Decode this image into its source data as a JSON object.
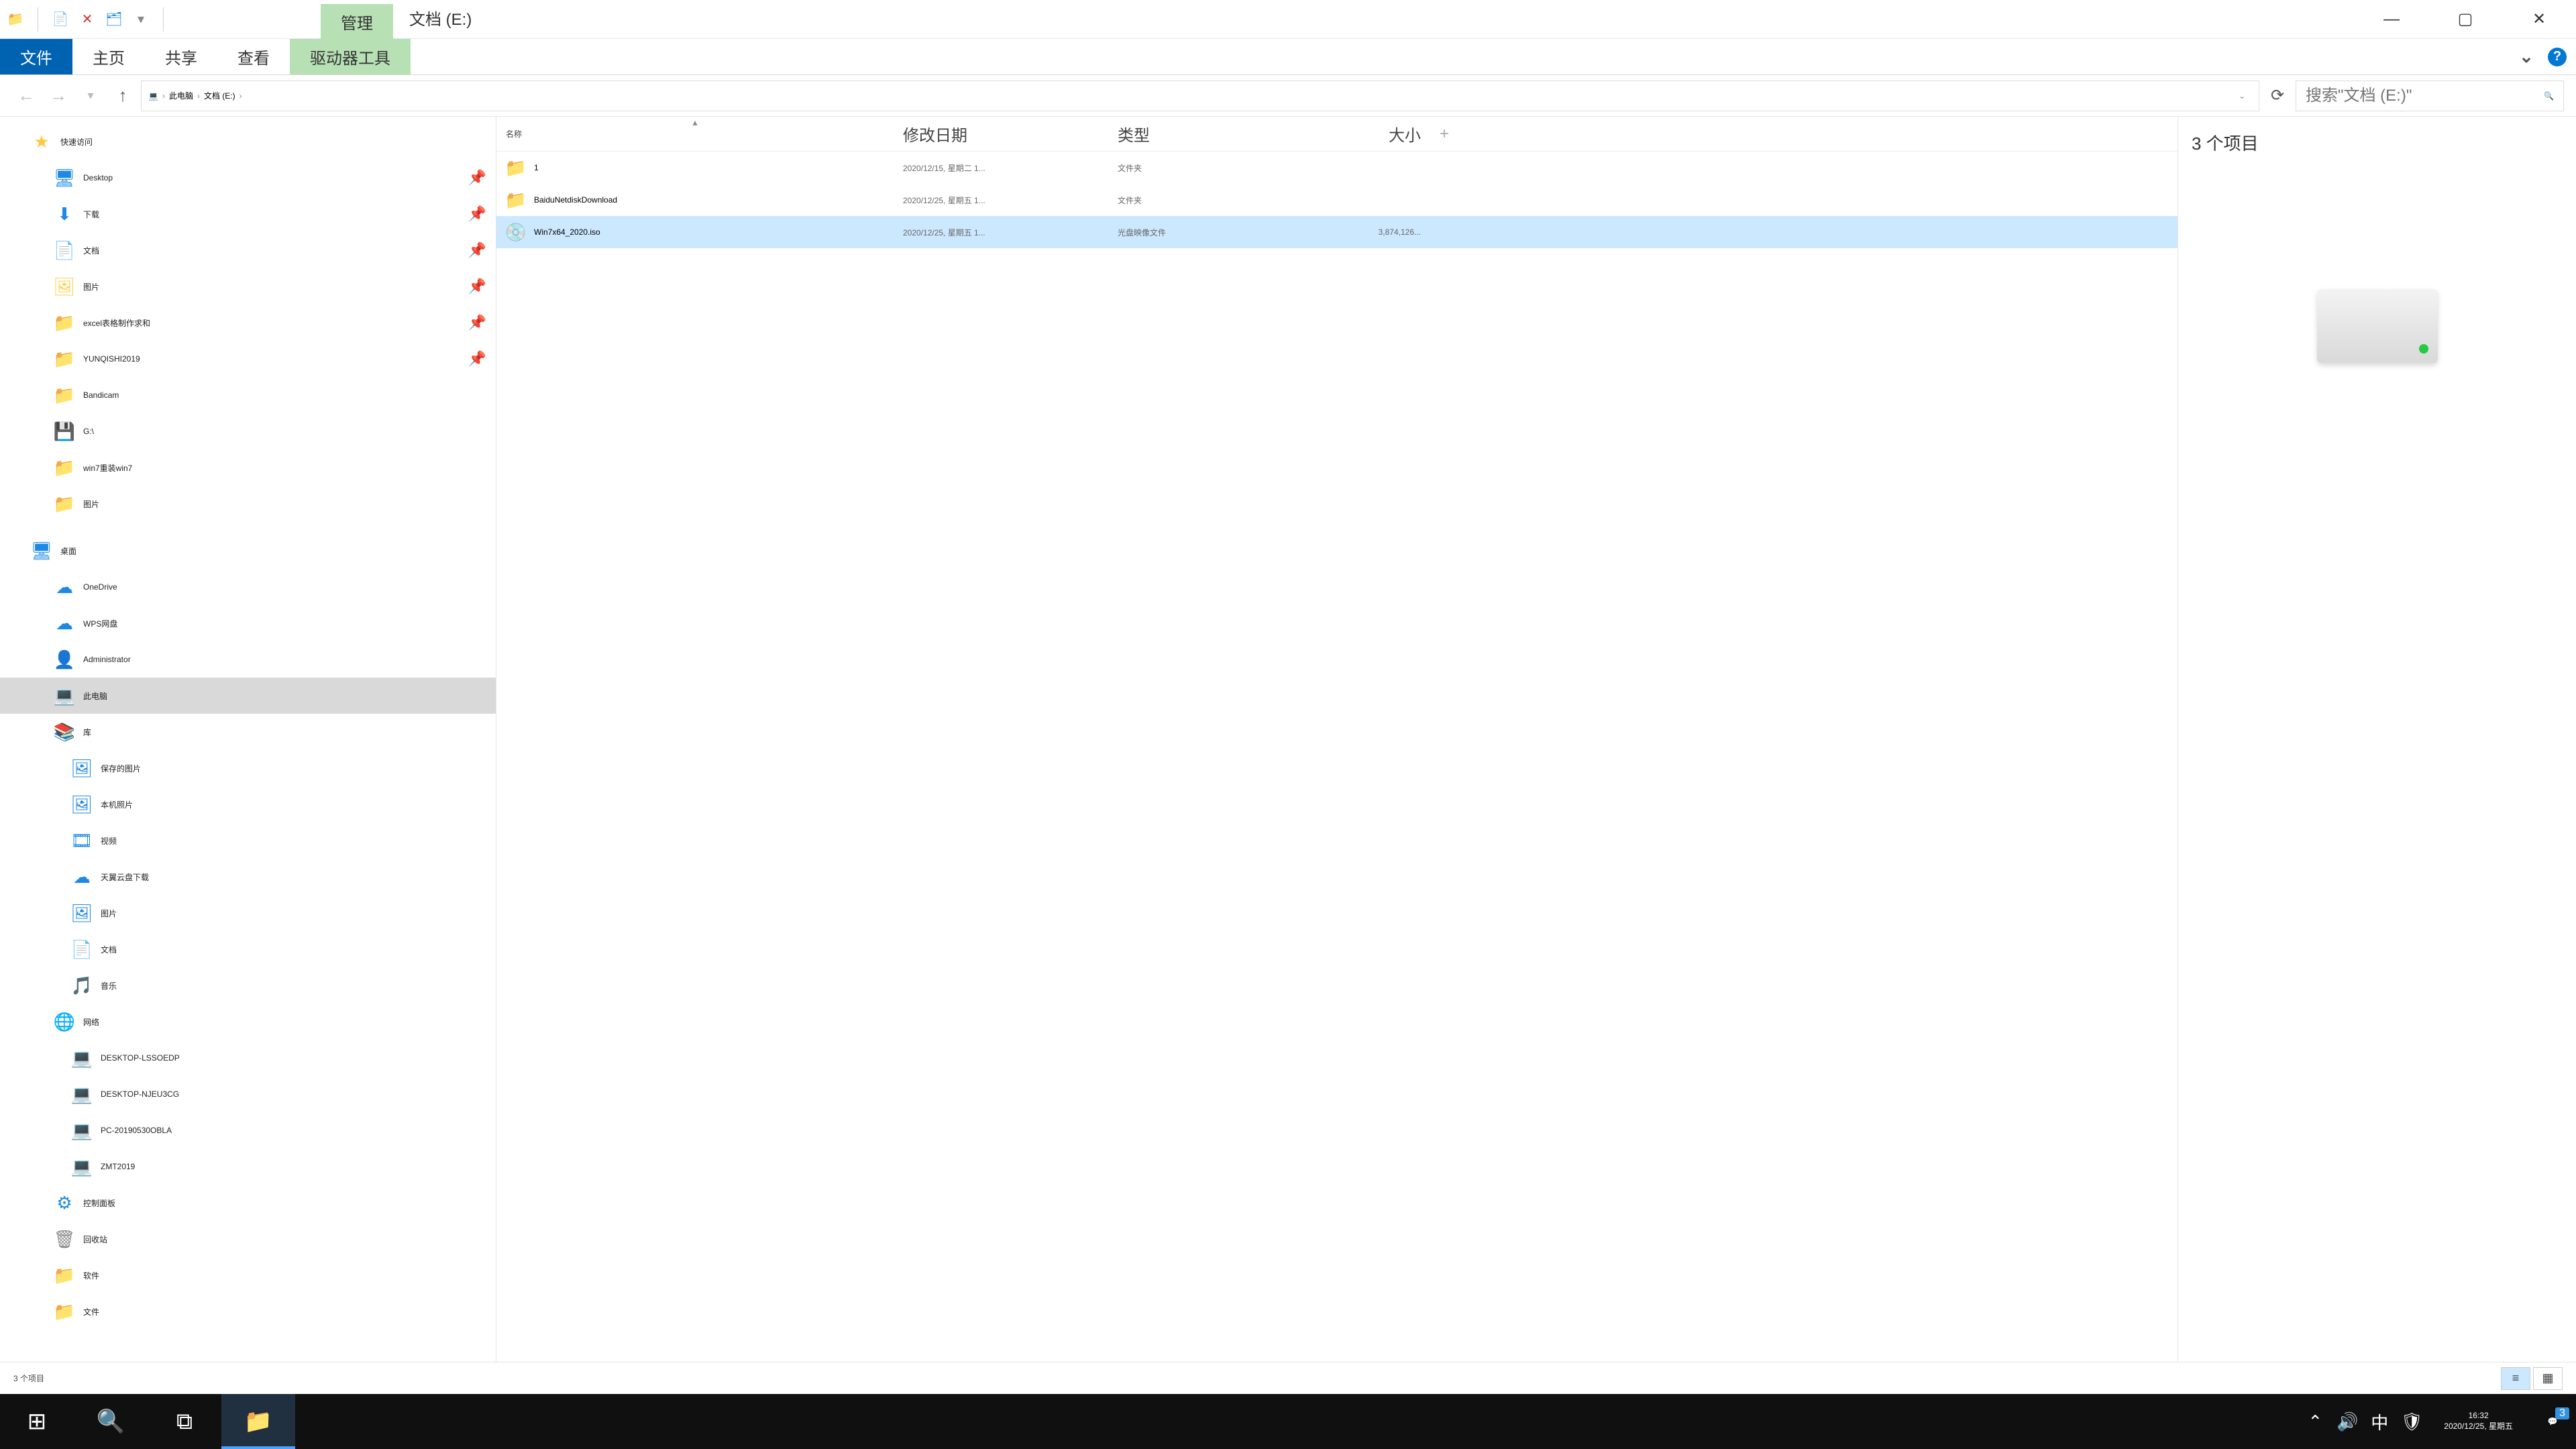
{
  "titlebar": {
    "context_tab": "管理",
    "title": "文档 (E:)"
  },
  "ribbon": {
    "file": "文件",
    "tabs": [
      "主页",
      "共享",
      "查看",
      "驱动器工具"
    ],
    "help_icon": "?"
  },
  "address": {
    "segments": [
      "此电脑",
      "文档 (E:)"
    ],
    "search_placeholder": "搜索\"文档 (E:)\""
  },
  "nav": {
    "quick": {
      "label": "快速访问",
      "items": [
        {
          "label": "Desktop",
          "icon": "🖥",
          "pin": true,
          "color": "blue"
        },
        {
          "label": "下载",
          "icon": "⬇",
          "pin": true,
          "color": "blue"
        },
        {
          "label": "文档",
          "icon": "📄",
          "pin": true,
          "color": "folder-yellow"
        },
        {
          "label": "图片",
          "icon": "🖼",
          "pin": true,
          "color": "folder-yellow"
        },
        {
          "label": "excel表格制作求和",
          "icon": "📁",
          "pin": true,
          "color": "folder-yellow"
        },
        {
          "label": "YUNQISHI2019",
          "icon": "📁",
          "pin": true,
          "color": "folder-yellow"
        },
        {
          "label": "Bandicam",
          "icon": "📁",
          "pin": false,
          "color": "folder-yellow"
        },
        {
          "label": "G:\\",
          "icon": "💾",
          "pin": false,
          "color": "gray"
        },
        {
          "label": "win7重装win7",
          "icon": "📁",
          "pin": false,
          "color": "folder-yellow"
        },
        {
          "label": "图片",
          "icon": "📁",
          "pin": false,
          "color": "folder-yellow"
        }
      ]
    },
    "desktop": {
      "label": "桌面",
      "items": [
        {
          "label": "OneDrive",
          "icon": "☁",
          "color": "blue"
        },
        {
          "label": "WPS网盘",
          "icon": "☁",
          "color": "blue"
        },
        {
          "label": "Administrator",
          "icon": "👤",
          "color": "folder-yellow"
        },
        {
          "label": "此电脑",
          "icon": "💻",
          "color": "blue",
          "selected": true
        },
        {
          "label": "库",
          "icon": "📚",
          "color": "folder-yellow"
        }
      ]
    },
    "libraries": [
      {
        "label": "保存的图片",
        "icon": "🖼",
        "color": "blue"
      },
      {
        "label": "本机照片",
        "icon": "🖼",
        "color": "blue"
      },
      {
        "label": "视频",
        "icon": "🎞",
        "color": "blue"
      },
      {
        "label": "天翼云盘下载",
        "icon": "☁",
        "color": "blue"
      },
      {
        "label": "图片",
        "icon": "🖼",
        "color": "blue"
      },
      {
        "label": "文档",
        "icon": "📄",
        "color": "blue"
      },
      {
        "label": "音乐",
        "icon": "🎵",
        "color": "blue"
      }
    ],
    "network": {
      "label": "网络",
      "items": [
        {
          "label": "DESKTOP-LSSOEDP",
          "icon": "💻",
          "color": "blue"
        },
        {
          "label": "DESKTOP-NJEU3CG",
          "icon": "💻",
          "color": "blue"
        },
        {
          "label": "PC-20190530OBLA",
          "icon": "💻",
          "color": "blue"
        },
        {
          "label": "ZMT2019",
          "icon": "💻",
          "color": "blue"
        }
      ]
    },
    "bottom": [
      {
        "label": "控制面板",
        "icon": "⚙",
        "color": "blue"
      },
      {
        "label": "回收站",
        "icon": "🗑",
        "color": "gray"
      },
      {
        "label": "软件",
        "icon": "📁",
        "color": "folder-yellow"
      },
      {
        "label": "文件",
        "icon": "📁",
        "color": "folder-yellow"
      }
    ]
  },
  "columns": {
    "name": "名称",
    "date": "修改日期",
    "type": "类型",
    "size": "大小"
  },
  "rows": [
    {
      "name": "1",
      "date": "2020/12/15, 星期二 1...",
      "type": "文件夹",
      "size": "",
      "icon": "📁",
      "iconColor": "folder-yellow"
    },
    {
      "name": "BaiduNetdiskDownload",
      "date": "2020/12/25, 星期五 1...",
      "type": "文件夹",
      "size": "",
      "icon": "📁",
      "iconColor": "folder-yellow"
    },
    {
      "name": "Win7x64_2020.iso",
      "date": "2020/12/25, 星期五 1...",
      "type": "光盘映像文件",
      "size": "3,874,126...",
      "icon": "💿",
      "iconColor": "gray",
      "selected": true
    }
  ],
  "preview": {
    "title": "3 个项目"
  },
  "status": {
    "text": "3 个项目"
  },
  "taskbar": {
    "time": "16:32",
    "date": "2020/12/25, 星期五",
    "ime": "中",
    "notif_count": "3"
  }
}
